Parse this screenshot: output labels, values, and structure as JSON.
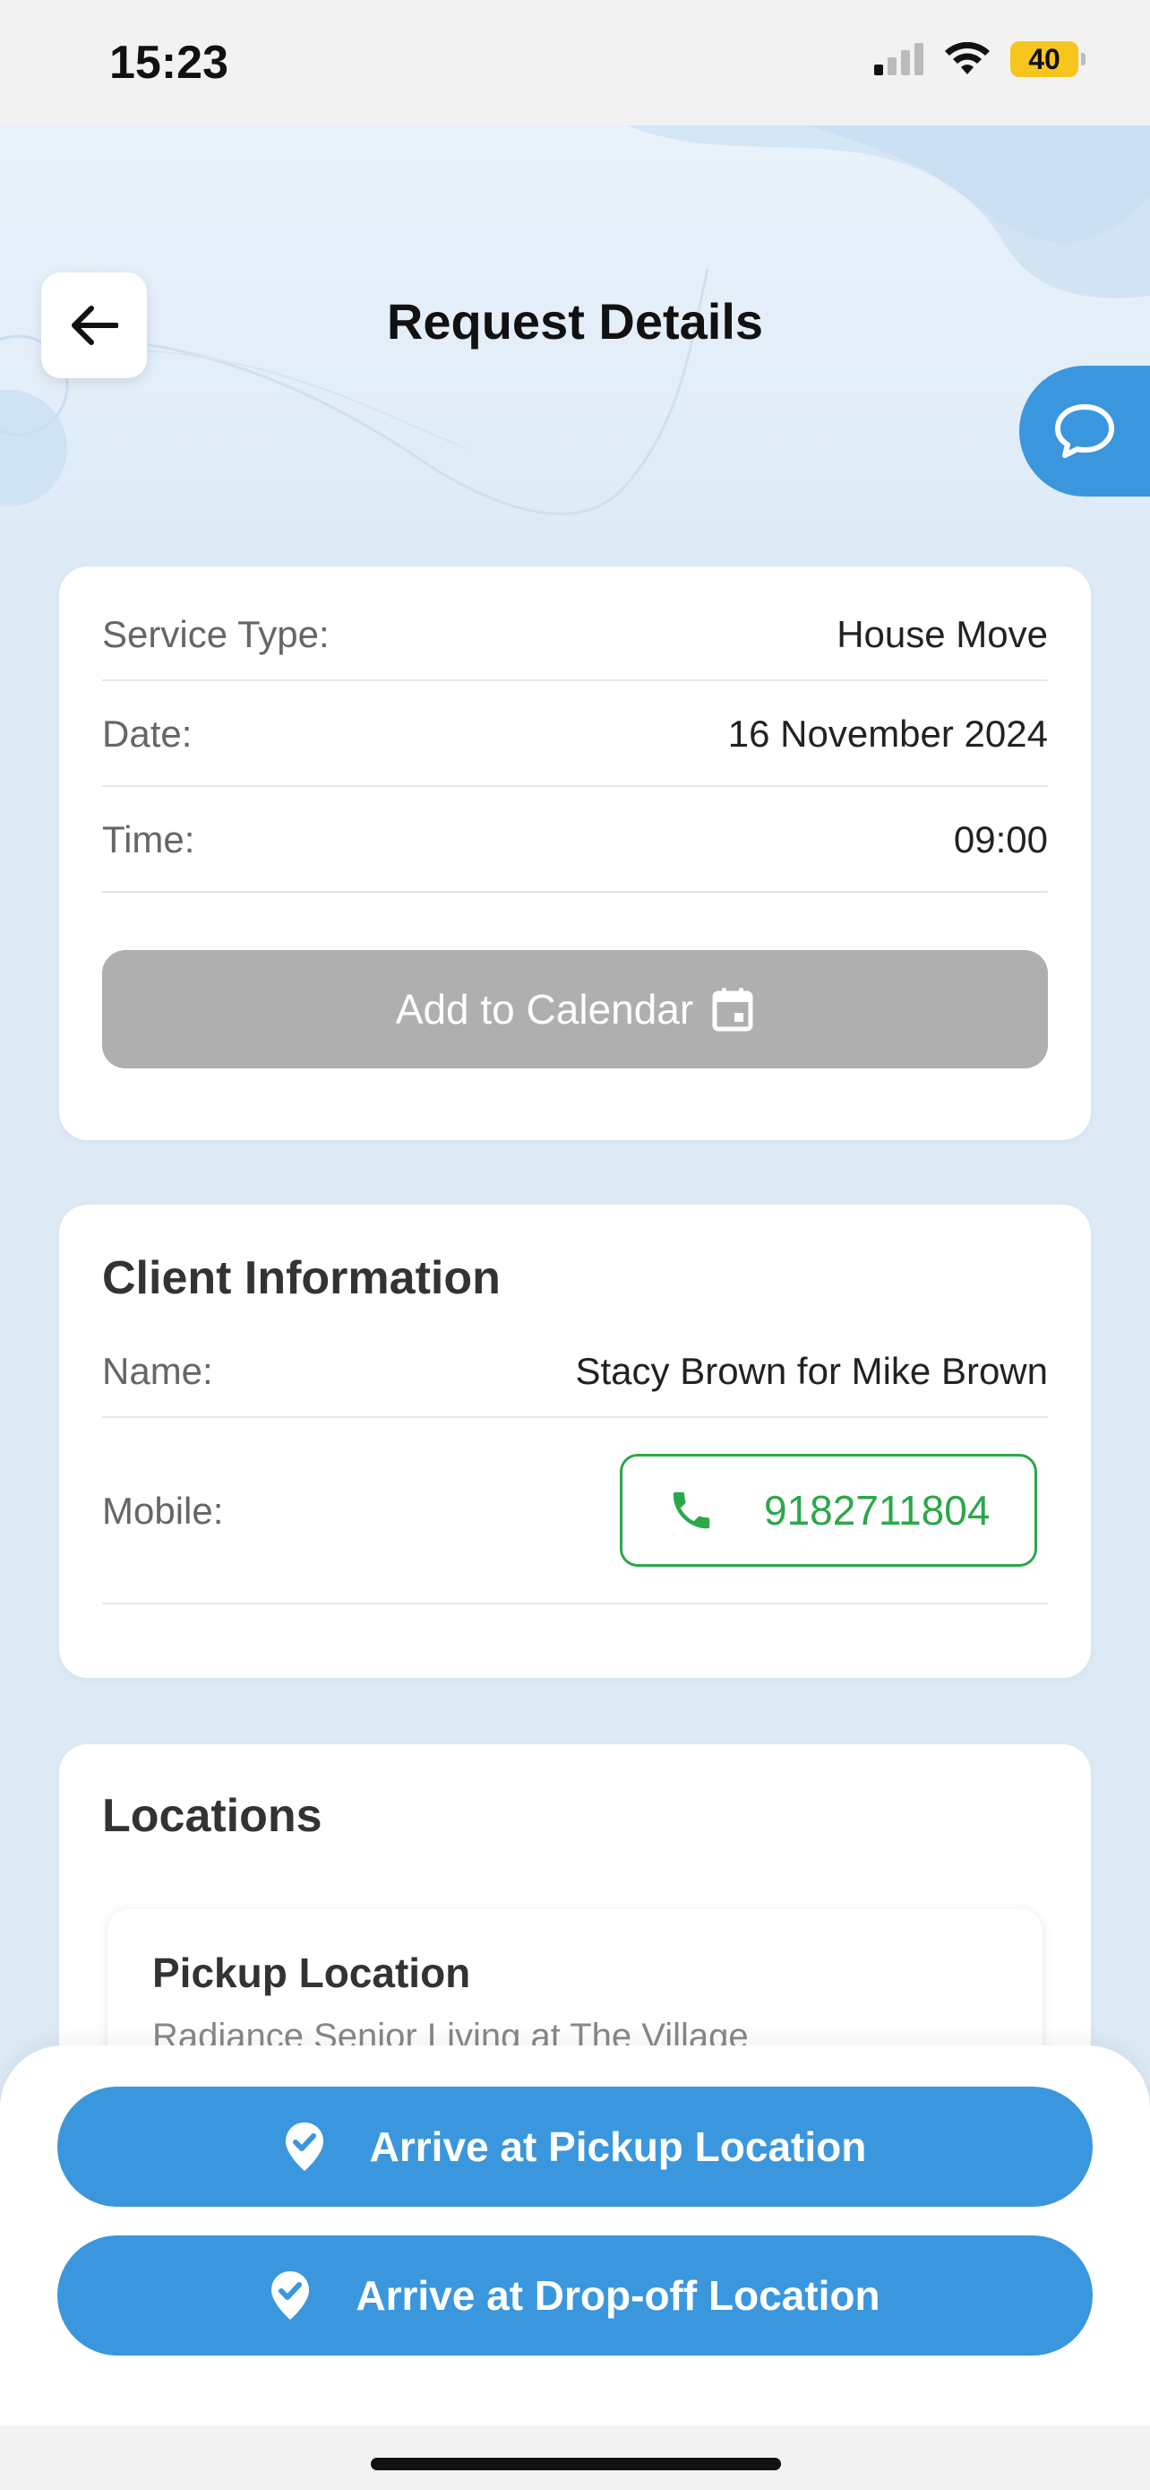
{
  "status": {
    "time": "15:23",
    "battery": "40"
  },
  "header": {
    "title": "Request Details"
  },
  "details": {
    "service_type_label": "Service Type:",
    "service_type_value": "House Move",
    "date_label": "Date:",
    "date_value": "16 November 2024",
    "time_label": "Time:",
    "time_value": "09:00",
    "calendar_button": "Add to Calendar"
  },
  "client": {
    "title": "Client Information",
    "name_label": "Name:",
    "name_value": "Stacy Brown for Mike Brown",
    "mobile_label": "Mobile:",
    "mobile_value": "9182711804"
  },
  "locations": {
    "title": "Locations",
    "pickup_title": "Pickup Location",
    "pickup_address": "Radiance Senior Living at The Village"
  },
  "actions": {
    "pickup_button": "Arrive at Pickup Location",
    "dropoff_button": "Arrive at Drop-off Location"
  },
  "colors": {
    "accent": "#3a97dd",
    "phone_green": "#2aa84a",
    "disabled_grey": "#afafaf"
  }
}
